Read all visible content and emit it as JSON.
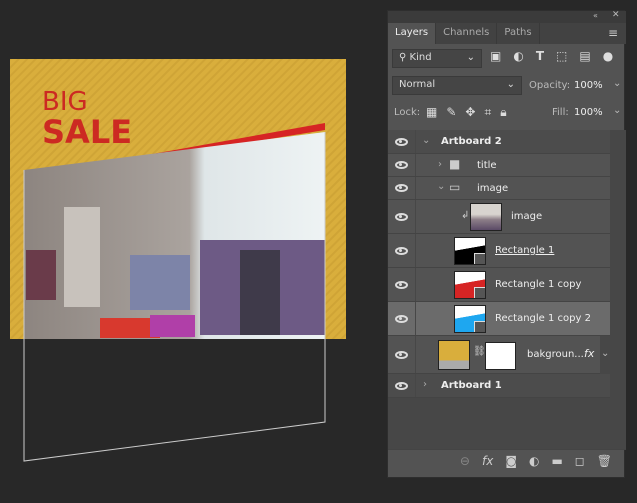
{
  "artwork": {
    "line1": "BIG",
    "line2": "SALE",
    "colors": {
      "background": "#d9ae3c",
      "text": "#cc2a22",
      "stripe": "#d62424"
    }
  },
  "panel": {
    "tabs": [
      {
        "label": "Layers",
        "active": true
      },
      {
        "label": "Channels"
      },
      {
        "label": "Paths"
      }
    ],
    "filter": {
      "value": "Kind"
    },
    "blend_mode": "Normal",
    "opacity_label": "Opacity:",
    "opacity": "100%",
    "lock_label": "Lock:",
    "fill_label": "Fill:",
    "fill": "100%",
    "layers": [
      {
        "name": "Artboard 2",
        "type": "artboard",
        "expanded": true
      },
      {
        "name": "title",
        "type": "group",
        "expanded": false
      },
      {
        "name": "image",
        "type": "group",
        "expanded": true
      },
      {
        "name": "image",
        "type": "clipped-image"
      },
      {
        "name": "Rectangle 1",
        "type": "shape",
        "color": "#000000"
      },
      {
        "name": "Rectangle 1 copy",
        "type": "shape",
        "color": "#d62424"
      },
      {
        "name": "Rectangle 1 copy 2",
        "type": "shape",
        "color": "#1ea7f0",
        "selected": true
      },
      {
        "name": "bakgroun...",
        "type": "fill",
        "color": "#d9ae3c",
        "fx": "fx"
      },
      {
        "name": "Artboard 1",
        "type": "artboard",
        "expanded": false
      }
    ],
    "bottom_icons": [
      "link-icon",
      "fx-icon",
      "mask-icon",
      "adjustment-icon",
      "folder-icon",
      "new-layer-icon",
      "trash-icon"
    ]
  }
}
